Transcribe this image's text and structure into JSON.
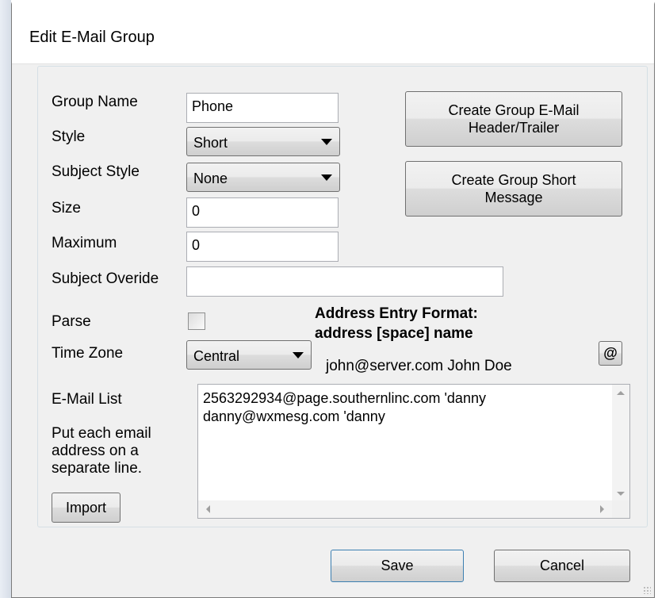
{
  "window": {
    "title": "Edit E-Mail Group"
  },
  "form": {
    "group_name": {
      "label": "Group Name",
      "value": "Phone"
    },
    "style": {
      "label": "Style",
      "value": "Short"
    },
    "subject_style": {
      "label": "Subject Style",
      "value": "None"
    },
    "size": {
      "label": "Size",
      "value": "0"
    },
    "maximum": {
      "label": "Maximum",
      "value": "0"
    },
    "subject_override": {
      "label": "Subject Overide",
      "value": ""
    },
    "parse": {
      "label": "Parse",
      "checked": false
    },
    "time_zone": {
      "label": "Time Zone",
      "value": "Central"
    },
    "email_list": {
      "label": "E-Mail List",
      "help": [
        "Put each email",
        "address  on a",
        "separate line."
      ],
      "lines": [
        "2563292934@page.southernlinc.com 'danny",
        "danny@wxmesg.com 'danny"
      ]
    }
  },
  "address_format": {
    "heading_line1": "Address Entry Format:",
    "heading_line2": "address [space] name",
    "example": "john@server.com  John Doe",
    "at_button": "@"
  },
  "buttons": {
    "header_trailer_line1": "Create Group E-Mail",
    "header_trailer_line2": "Header/Trailer",
    "short_message_line1": "Create Group Short",
    "short_message_line2": "Message",
    "import": "Import",
    "save": "Save",
    "cancel": "Cancel"
  }
}
